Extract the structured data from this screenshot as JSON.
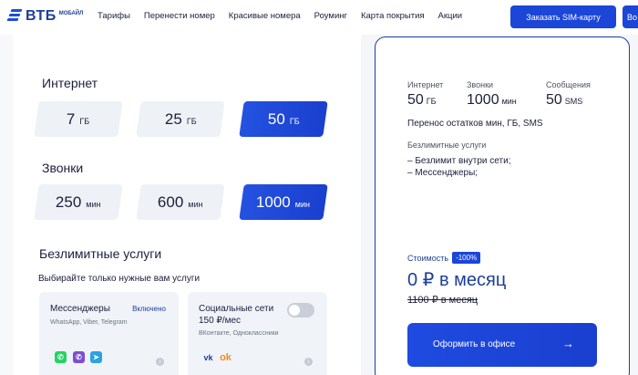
{
  "header": {
    "logo_text": "ВТБ",
    "logo_sub": "МОБАЙЛ",
    "nav": [
      "Тарифы",
      "Перенести номер",
      "Красивые номера",
      "Роуминг",
      "Карта покрытия",
      "Акции"
    ],
    "order_sim_label": "Заказать SIM-карту",
    "second_button_label": "Во"
  },
  "internet": {
    "title": "Интернет",
    "options": [
      {
        "value": "7",
        "unit": "ГБ"
      },
      {
        "value": "25",
        "unit": "ГБ"
      },
      {
        "value": "50",
        "unit": "ГБ"
      }
    ],
    "selected": "50 ГБ"
  },
  "calls": {
    "title": "Звонки",
    "options": [
      {
        "value": "250",
        "unit": "мин"
      },
      {
        "value": "600",
        "unit": "мин"
      },
      {
        "value": "1000",
        "unit": "мин"
      }
    ],
    "selected": "1000 мин"
  },
  "services": {
    "title": "Безлимитные услуги",
    "subtitle": "Выбирайте только нужные вам услуги",
    "items": [
      {
        "name": "Мессенджеры",
        "status": "Включено",
        "desc": "WhatsApp, Viber, Telegram",
        "icons": [
          "whatsapp-icon",
          "viber-icon",
          "telegram-icon"
        ]
      },
      {
        "name": "Социальные сети",
        "price": "150 ₽/мес",
        "desc": "ВКонтакте, Одноклассники",
        "enabled": false,
        "icons": [
          "vk-icon",
          "odnoklassniki-icon"
        ]
      }
    ]
  },
  "summary": {
    "internet_label": "Интернет",
    "internet_value": "50",
    "internet_unit": "ГБ",
    "calls_label": "Звонки",
    "calls_value": "1000",
    "calls_unit": "мин",
    "sms_label": "Сообщения",
    "sms_value": "50",
    "sms_unit": "SMS",
    "transfer_text": "Перенос остатков мин, ГБ, SMS",
    "unlimited_title": "Безлимитные услуги",
    "unlimited_items": [
      "– Безлимит внутри сети;",
      "– Мессенджеры;"
    ],
    "cost_label": "Стоимость",
    "discount_badge": "-100%",
    "price": "0 ₽ в месяц",
    "old_price": "1100 ₽ в месяц",
    "button_label": "Оформить в офисе",
    "button_arrow": "→"
  },
  "colors": {
    "accent": "#1b46d8",
    "brand": "#1d3f9a",
    "option_bg": "#eef1f6"
  }
}
